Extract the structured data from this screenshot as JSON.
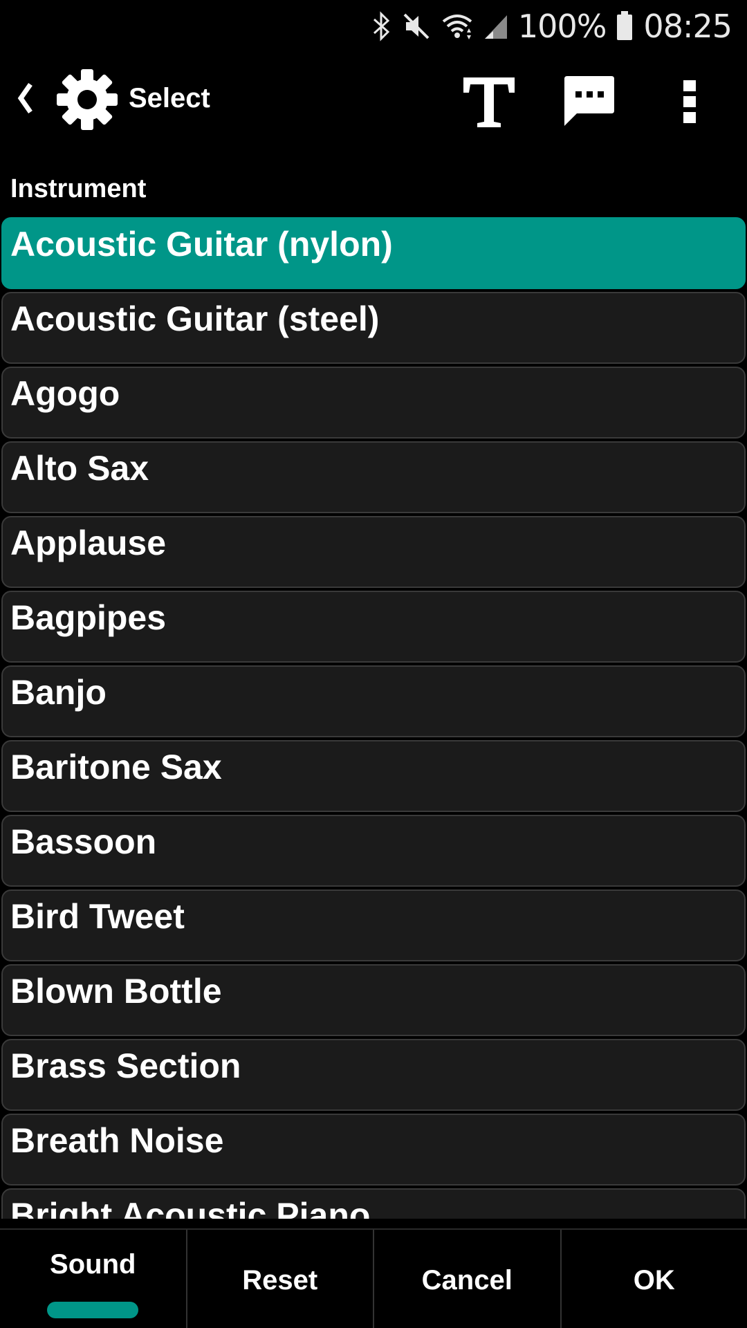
{
  "status_bar": {
    "battery": "100%",
    "time": "08:25",
    "icons": [
      "bluetooth-icon",
      "mute-icon",
      "wifi-icon",
      "signal-icon",
      "battery-icon"
    ]
  },
  "toolbar": {
    "back_icon": "chevron-left-icon",
    "settings_icon": "gear-icon",
    "title": "Select",
    "text_icon": "text-format-icon",
    "comment_icon": "comment-icon",
    "more_icon": "more-vert-icon"
  },
  "section": {
    "label": "Instrument"
  },
  "instruments": {
    "items": [
      {
        "label": "Acoustic Guitar (nylon)",
        "selected": true
      },
      {
        "label": "Acoustic Guitar (steel)",
        "selected": false
      },
      {
        "label": "Agogo",
        "selected": false
      },
      {
        "label": "Alto Sax",
        "selected": false
      },
      {
        "label": "Applause",
        "selected": false
      },
      {
        "label": "Bagpipes",
        "selected": false
      },
      {
        "label": "Banjo",
        "selected": false
      },
      {
        "label": "Baritone Sax",
        "selected": false
      },
      {
        "label": "Bassoon",
        "selected": false
      },
      {
        "label": "Bird Tweet",
        "selected": false
      },
      {
        "label": "Blown Bottle",
        "selected": false
      },
      {
        "label": "Brass Section",
        "selected": false
      },
      {
        "label": "Breath Noise",
        "selected": false
      },
      {
        "label": "Bright Acoustic Piano",
        "selected": false
      }
    ]
  },
  "bottom_bar": {
    "sound": "Sound",
    "reset": "Reset",
    "cancel": "Cancel",
    "ok": "OK"
  },
  "colors": {
    "accent": "#009688",
    "background": "#000000",
    "item_background": "#1b1b1b",
    "item_border": "#3a3a3a"
  }
}
